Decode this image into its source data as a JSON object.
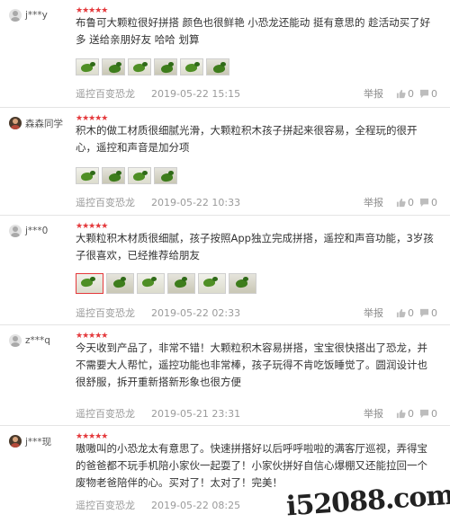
{
  "reviews": [
    {
      "username": "j***y",
      "avatar": "default",
      "stars": "★★★★★",
      "text": "布鲁可大颗粒很好拼搭 颜色也很鲜艳 小恐龙还能动 挺有意思的 趁活动买了好多 送给亲朋好友 哈哈 划算",
      "product": "遥控百变恐龙",
      "date": "2019-05-22 15:15",
      "report": "举报",
      "likes": "0",
      "replies": "0"
    },
    {
      "username": "森森同学",
      "avatar": "photo",
      "stars": "★★★★★",
      "text": "积木的做工材质很细腻光滑，大颗粒积木孩子拼起来很容易，全程玩的很开心，遥控和声音是加分项",
      "product": "遥控百变恐龙",
      "date": "2019-05-22 10:33",
      "report": "举报",
      "likes": "0",
      "replies": "0"
    },
    {
      "username": "j***0",
      "avatar": "default",
      "stars": "★★★★★",
      "text": "大颗粒积木材质很细腻，孩子按照App独立完成拼搭，遥控和声音功能，3岁孩子很喜欢，已经推荐给朋友",
      "product": "遥控百变恐龙",
      "date": "2019-05-22 02:33",
      "report": "举报",
      "likes": "0",
      "replies": "0"
    },
    {
      "username": "z***q",
      "avatar": "default",
      "stars": "★★★★★",
      "text": "今天收到产品了，非常不错！大颗粒积木容易拼搭，宝宝很快搭出了恐龙，并不需要大人帮忙，遥控功能也非常棒，孩子玩得不肯吃饭睡觉了。圆润设计也很舒服，拆开重新搭新形象也很方便",
      "product": "遥控百变恐龙",
      "date": "2019-05-21 23:31",
      "report": "举报",
      "likes": "0",
      "replies": "0"
    },
    {
      "username": "j***现",
      "avatar": "photo",
      "stars": "★★★★★",
      "text": "嗷嗷叫的小恐龙太有意思了。快速拼搭好以后呼呼啦啦的满客厅巡视，弄得宝的爸爸都不玩手机陪小家伙一起耍了！小家伙拼好自信心爆棚又还能拉回一个废物老爸陪伴的心。买对了！太对了！完美！",
      "product": "遥控百变恐龙",
      "date": "2019-05-22 08:25",
      "report": "举报",
      "likes": "0",
      "replies": "0"
    }
  ],
  "watermark": "i52088.com"
}
